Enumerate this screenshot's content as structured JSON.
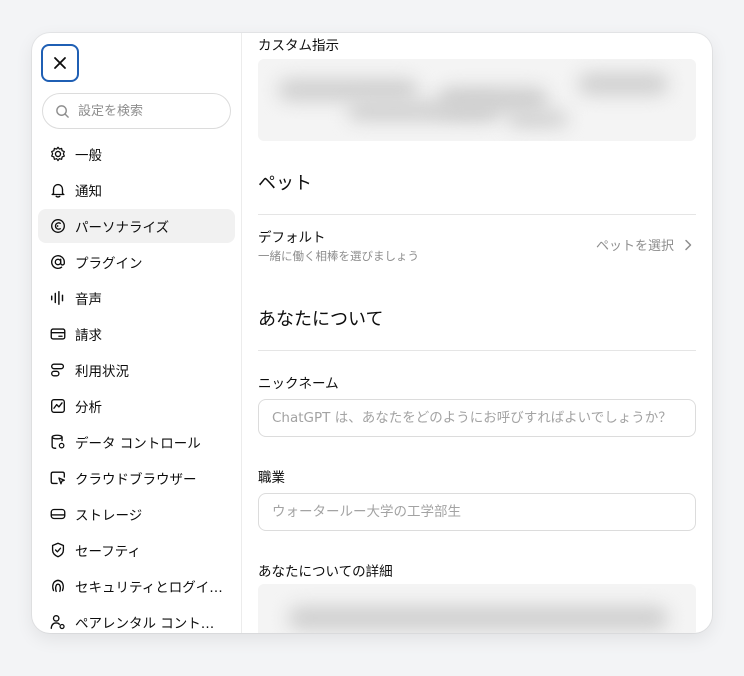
{
  "sidebar": {
    "search_placeholder": "設定を検索",
    "items": [
      {
        "label": "一般",
        "icon": "gear-icon",
        "active": false
      },
      {
        "label": "通知",
        "icon": "bell-icon",
        "active": false
      },
      {
        "label": "パーソナライズ",
        "icon": "personalize-icon",
        "active": true
      },
      {
        "label": "プラグイン",
        "icon": "at-icon",
        "active": false
      },
      {
        "label": "音声",
        "icon": "waveform-icon",
        "active": false
      },
      {
        "label": "請求",
        "icon": "card-icon",
        "active": false
      },
      {
        "label": "利用状況",
        "icon": "usage-icon",
        "active": false
      },
      {
        "label": "分析",
        "icon": "chart-icon",
        "active": false
      },
      {
        "label": "データ コントロール",
        "icon": "database-gear-icon",
        "active": false
      },
      {
        "label": "クラウドブラウザー",
        "icon": "browser-cursor-icon",
        "active": false
      },
      {
        "label": "ストレージ",
        "icon": "storage-icon",
        "active": false
      },
      {
        "label": "セーフティ",
        "icon": "shield-icon",
        "active": false
      },
      {
        "label": "セキュリティとログイ…",
        "icon": "fingerprint-icon",
        "active": false
      },
      {
        "label": "ペアレンタル コント…",
        "icon": "parent-icon",
        "active": false
      }
    ]
  },
  "main": {
    "custom_instructions_label": "カスタム指示",
    "pet": {
      "heading": "ペット",
      "default_title": "デフォルト",
      "default_subtitle": "一緒に働く相棒を選びましょう",
      "select_label": "ペットを選択"
    },
    "about": {
      "heading": "あなたについて",
      "nickname_label": "ニックネーム",
      "nickname_placeholder": "ChatGPT は、あなたをどのようにお呼びすればよいでしょうか？",
      "occupation_label": "職業",
      "occupation_placeholder": "ウォータールー大学の工学部生",
      "details_label": "あなたについての詳細"
    }
  }
}
